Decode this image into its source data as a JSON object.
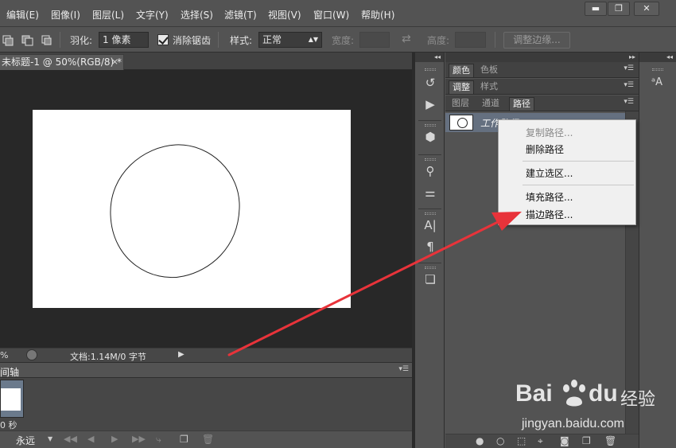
{
  "menubar": {
    "items": [
      "编辑(E)",
      "图像(I)",
      "图层(L)",
      "文字(Y)",
      "选择(S)",
      "滤镜(T)",
      "视图(V)",
      "窗口(W)",
      "帮助(H)"
    ],
    "window_controls": [
      "▬",
      "❐",
      "✕"
    ]
  },
  "options": {
    "feather_label": "羽化:",
    "feather_value": "1 像素",
    "antialias_label": "消除锯齿",
    "antialias_checked": true,
    "style_label": "样式:",
    "style_value": "正常",
    "width_label": "宽度:",
    "height_label": "高度:",
    "refine_edge_label": "调整边缘..."
  },
  "document": {
    "tab_title": "未标题-1 @ 50%(RGB/8) *",
    "close_glyph": "×"
  },
  "statusbar": {
    "zoom": "%",
    "doc_info": "文档:1.14M/0 字节"
  },
  "timeline": {
    "title": "间轴",
    "frame_delay": "0 秒",
    "loop_value": "永远"
  },
  "panels": {
    "group1_tabs": [
      "颜色",
      "色板"
    ],
    "group2_tabs": [
      "调整",
      "样式"
    ],
    "group3_tabs": [
      "图层",
      "通道",
      "路径"
    ],
    "active_tab": "路径",
    "work_path_name": "工作路径"
  },
  "context_menu": {
    "items": [
      "复制路径...",
      "删除路径",
      "建立选区...",
      "填充路径...",
      "描边路径..."
    ],
    "disabled": [
      "复制路径..."
    ]
  },
  "watermark": {
    "brand": "Bai",
    "brand_suffix": "du",
    "tagline": "经验",
    "url": "jingyan.baidu.com"
  },
  "colors": {
    "arrow": "#e8333a",
    "selected_row": "#657080",
    "canvas_bg": "#282828"
  }
}
